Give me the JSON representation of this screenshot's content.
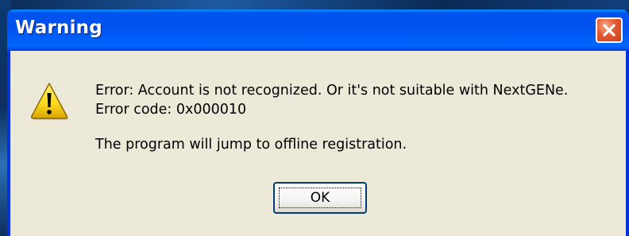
{
  "dialog": {
    "title": "Warning",
    "close_icon": "close-icon",
    "warning_icon": "warning-icon",
    "message_lines": [
      "Error: Account is not recognized. Or it's not suitable with NextGENe.",
      "Error code: 0x000010",
      "The program will jump to offline registration."
    ],
    "ok_label": "OK"
  },
  "colors": {
    "titlebar": "#0053ee",
    "client_background": "#ece9d8",
    "close_button": "#e25a33",
    "warning_fill": "#f9d71c"
  }
}
